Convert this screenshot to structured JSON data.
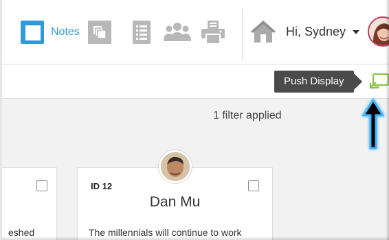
{
  "header": {
    "notes_label": "Notes",
    "greeting": "Hi, Sydney",
    "tools": [
      {
        "name": "stack-icon"
      },
      {
        "name": "document-icon"
      },
      {
        "name": "people-icon"
      },
      {
        "name": "print-icon"
      }
    ]
  },
  "toolbar": {
    "tooltip": "Push Display",
    "push_icon": "push-display-icon"
  },
  "filter": {
    "text": "1 filter applied"
  },
  "cards": [
    {
      "snippet": "eshed"
    },
    {
      "id": "ID 12",
      "name": "Dan Mu",
      "text": "The millennials will continue to work"
    }
  ],
  "colors": {
    "accent": "#2e9bd6",
    "push_green": "#8bc34a",
    "tooltip_bg": "#4a4a4a",
    "arrow_glow": "#3fb7ff"
  }
}
